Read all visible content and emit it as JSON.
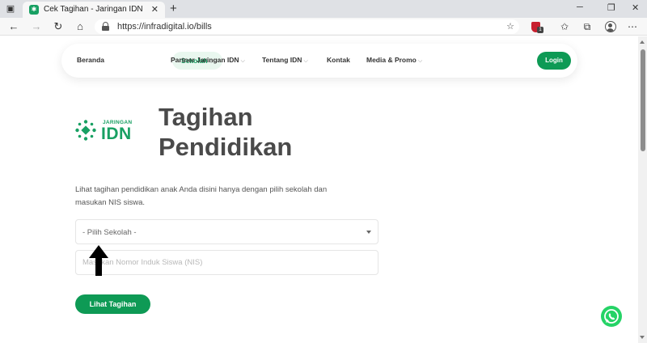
{
  "browser": {
    "tab_title": "Cek Tagihan - Jaringan IDN",
    "url": "https://infradigital.io/bills",
    "extension_badge": "1"
  },
  "nav": {
    "items": [
      {
        "label": "Beranda",
        "caret": false,
        "active": false
      },
      {
        "label": "Sekolah",
        "caret": true,
        "active": true
      },
      {
        "label": "Partner Jaringan IDN",
        "caret": true,
        "active": false
      },
      {
        "label": "Tentang IDN",
        "caret": true,
        "active": false
      },
      {
        "label": "Kontak",
        "caret": false,
        "active": false
      },
      {
        "label": "Media & Promo",
        "caret": true,
        "active": false
      }
    ],
    "login_label": "Login"
  },
  "logo": {
    "small_text": "JARINGAN",
    "big_text": "IDN"
  },
  "hero": {
    "line1": "Tagihan",
    "line2": "Pendidikan"
  },
  "form": {
    "description": "Lihat tagihan pendidikan anak Anda disini hanya dengan pilih sekolah dan masukan NIS siswa.",
    "school_select_value": "- Pilih Sekolah -",
    "nis_placeholder": "Masukan Nomor Induk Siswa (NIS)",
    "nis_value": "",
    "submit_label": "Lihat Tagihan"
  },
  "colors": {
    "brand_green": "#0e9a55",
    "whatsapp_green": "#25d366"
  }
}
